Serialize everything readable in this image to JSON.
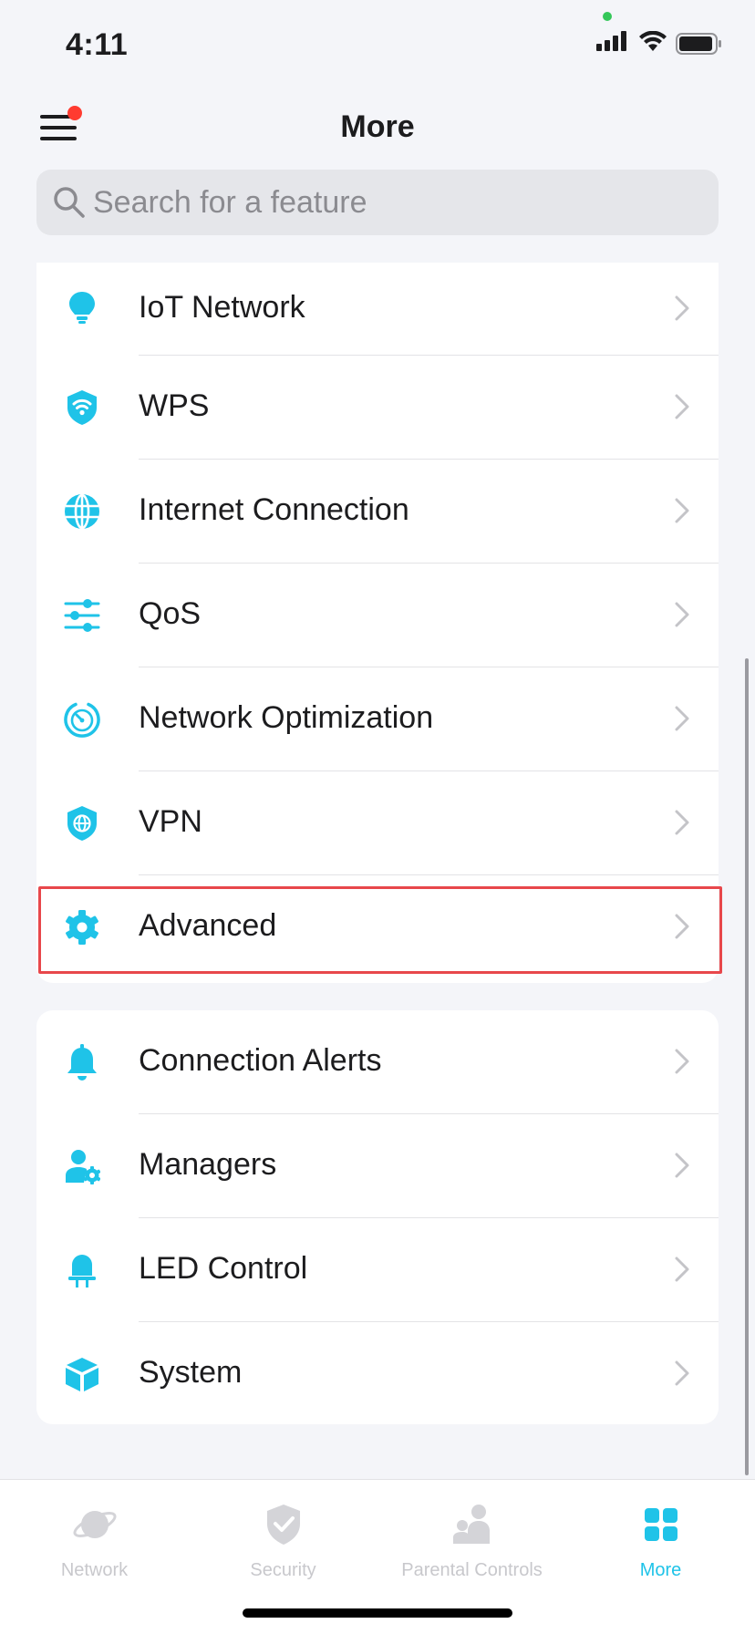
{
  "status_bar": {
    "time": "4:11"
  },
  "header": {
    "title": "More"
  },
  "search": {
    "placeholder": "Search for a feature"
  },
  "colors": {
    "accent": "#1fc3e8",
    "highlight": "#e8474b",
    "badge": "#ff3b30"
  },
  "section1": {
    "items": [
      {
        "label": "IoT Network",
        "icon": "lightbulb-icon"
      },
      {
        "label": "WPS",
        "icon": "wifi-shield-icon"
      },
      {
        "label": "Internet Connection",
        "icon": "globe-icon"
      },
      {
        "label": "QoS",
        "icon": "sliders-icon"
      },
      {
        "label": "Network Optimization",
        "icon": "speedometer-icon"
      },
      {
        "label": "VPN",
        "icon": "vpn-shield-icon"
      },
      {
        "label": "Advanced",
        "icon": "gear-icon"
      }
    ]
  },
  "section2": {
    "items": [
      {
        "label": "Connection Alerts",
        "icon": "bell-icon"
      },
      {
        "label": "Managers",
        "icon": "manager-icon"
      },
      {
        "label": "LED Control",
        "icon": "led-icon"
      },
      {
        "label": "System",
        "icon": "cube-icon"
      }
    ]
  },
  "tabbar": {
    "tabs": [
      {
        "label": "Network",
        "icon": "planet-icon",
        "active": false
      },
      {
        "label": "Security",
        "icon": "shield-check-icon",
        "active": false
      },
      {
        "label": "Parental Controls",
        "icon": "family-icon",
        "active": false
      },
      {
        "label": "More",
        "icon": "grid-icon",
        "active": true
      }
    ]
  }
}
